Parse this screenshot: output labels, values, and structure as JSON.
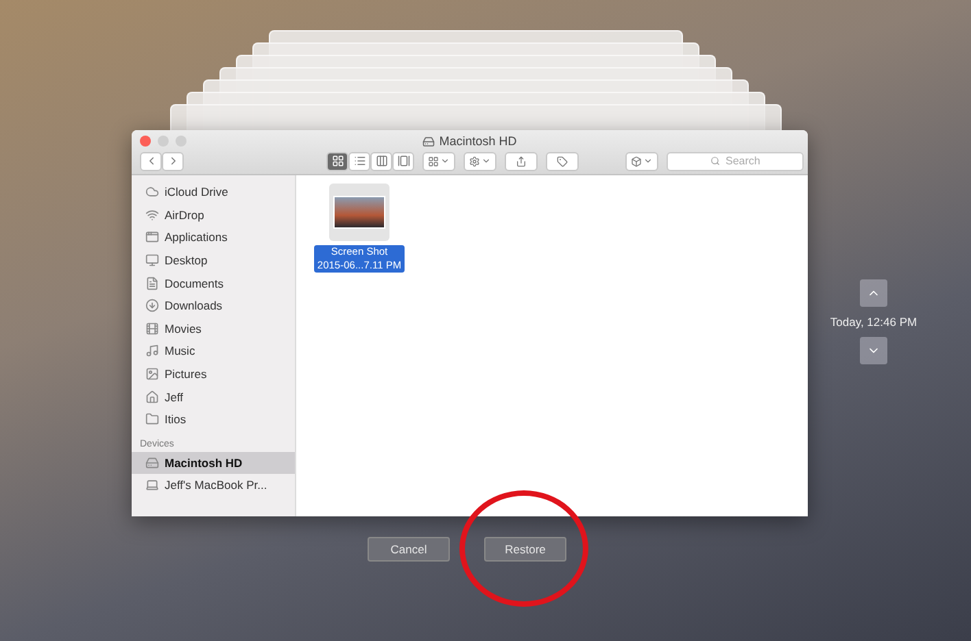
{
  "window": {
    "title": "Macintosh HD"
  },
  "toolbar": {
    "view_modes": [
      {
        "kind": "icons",
        "selected": true
      },
      {
        "kind": "list",
        "selected": false
      },
      {
        "kind": "columns",
        "selected": false
      },
      {
        "kind": "coverflow",
        "selected": false
      }
    ],
    "search": {
      "placeholder": "Search"
    }
  },
  "sidebar": {
    "favorites": [
      {
        "label": "iCloud Drive",
        "kind": "cloud"
      },
      {
        "label": "AirDrop",
        "kind": "airdrop"
      },
      {
        "label": "Applications",
        "kind": "apps"
      },
      {
        "label": "Desktop",
        "kind": "desktop"
      },
      {
        "label": "Documents",
        "kind": "documents"
      },
      {
        "label": "Downloads",
        "kind": "downloads"
      },
      {
        "label": "Movies",
        "kind": "movies"
      },
      {
        "label": "Music",
        "kind": "music"
      },
      {
        "label": "Pictures",
        "kind": "pictures"
      },
      {
        "label": "Jeff",
        "kind": "home"
      },
      {
        "label": "Itios",
        "kind": "folder"
      }
    ],
    "devices_heading": "Devices",
    "devices": [
      {
        "label": "Macintosh HD",
        "kind": "disk",
        "selected": true
      },
      {
        "label": "Jeff's MacBook Pr...",
        "kind": "laptop",
        "selected": false
      }
    ]
  },
  "files": [
    {
      "name_lines": [
        "Screen Shot",
        "2015-06...7.11 PM"
      ],
      "selected": true
    }
  ],
  "timeline": {
    "date": "Today, 12:46 PM"
  },
  "buttons": [
    {
      "label": "Cancel",
      "circled": false
    },
    {
      "label": "Restore",
      "circled": true
    }
  ]
}
